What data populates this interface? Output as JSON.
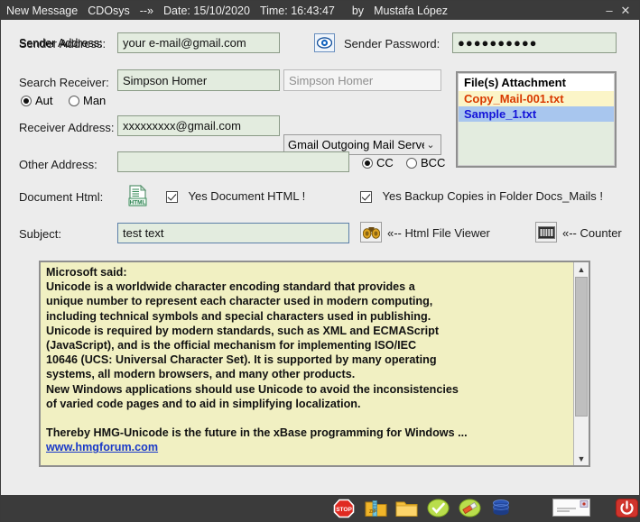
{
  "titlebar": {
    "app": "New Message",
    "engine": "CDOsys",
    "arrow": "--»",
    "date": "Date: 15/10/2020",
    "time": "Time: 16:43:47",
    "by": "by",
    "author": "Mustafa López",
    "minimize": "–",
    "close": "✕"
  },
  "form": {
    "sender_address_label": "Sender Address:",
    "sender_address_value": "your e-mail@gmail.com",
    "sender_password_label": "Sender Password:",
    "sender_password_value": "●●●●●●●●●●",
    "search_receiver_label": "Search Receiver:",
    "search_receiver_value": "Simpson Homer",
    "search_receiver_ghost": "Simpson Homer",
    "mode_aut": "Aut",
    "mode_man": "Man",
    "mode_selected": "Aut",
    "receiver_address_label": "Receiver Address:",
    "receiver_address_value": "xxxxxxxxx@gmail.com",
    "server_combo_value": "Gmail  Outgoing Mail Serve",
    "other_address_label": "Other Address:",
    "other_address_value": "",
    "cc_label": "CC",
    "bcc_label": "BCC",
    "copy_selected": "CC",
    "document_html_label": "Document Html:",
    "doc_html_icon_text": "HTML",
    "yes_document_html": "Yes Document HTML !",
    "yes_document_html_checked": true,
    "yes_backup_copies": "Yes Backup Copies in Folder Docs_Mails !",
    "yes_backup_copies_checked": true,
    "subject_label": "Subject:",
    "subject_value": "test text",
    "html_file_viewer": "«-- Html File Viewer",
    "counter": "«-- Counter"
  },
  "attachment": {
    "header": "File(s)  Attachment",
    "files": [
      "Copy_Mail-001.txt",
      "Sample_1.txt"
    ]
  },
  "message": {
    "text": "Microsoft said:\nUnicode is a worldwide character encoding standard that provides a\nunique number to represent each character used in modern computing,\nincluding technical symbols and special characters used in publishing.\nUnicode is required by modern standards, such as XML and ECMAScript\n(JavaScript), and is the official mechanism for implementing ISO/IEC\n10646 (UCS: Universal Character Set). It is supported by many operating\nsystems, all modern browsers, and many other products.\nNew Windows applications should use Unicode to avoid the inconsistencies\nof varied code pages and to aid in simplifying localization.\n\nThereby HMG-Unicode is the future in the xBase programming for Windows ...\n",
    "link": "www.hmgforum.com"
  },
  "toolbar": {
    "icons": [
      "stop-icon",
      "zip-folder-icon",
      "folder-icon",
      "green-check-icon",
      "green-eraser-icon",
      "database-icon",
      "mail-envelope-icon",
      "power-off-icon"
    ]
  },
  "colors": {
    "titlebar_bg": "#3b3b3b",
    "window_bg": "#ececec",
    "field_bg": "#e3ecdf",
    "body_bg": "#f1f0c2",
    "link": "#1a39c8",
    "attachment_1": "#d93a00",
    "attachment_2": "#1414d8"
  }
}
